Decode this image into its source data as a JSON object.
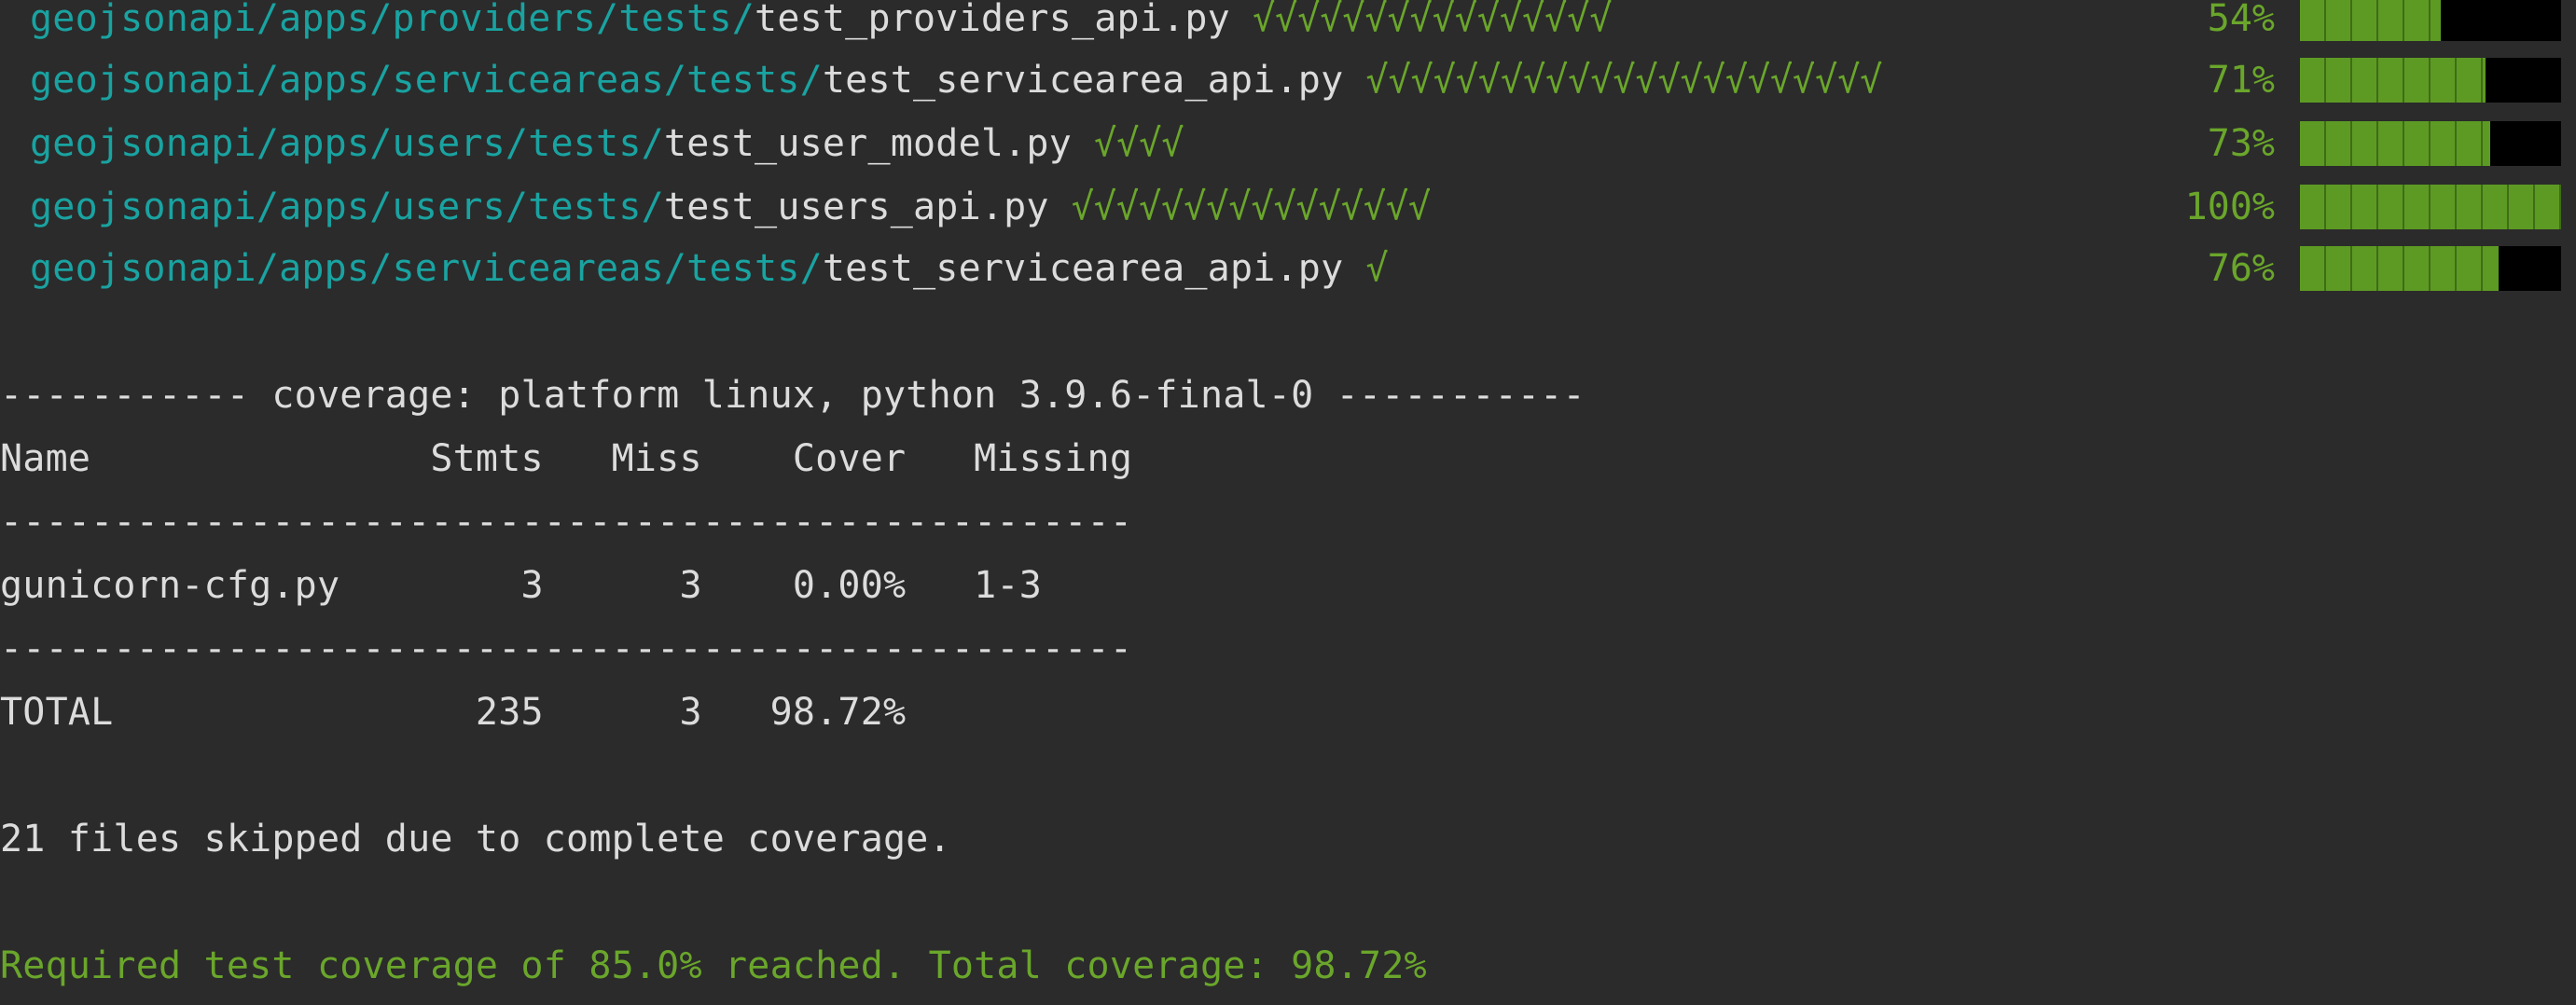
{
  "tests": [
    {
      "dir": "geojsonapi/apps/providers/tests/",
      "file": "test_providers_api.py",
      "checks": "√√√√√√√√√√√√√√√√",
      "percent_label": "54%",
      "progress": 0.54
    },
    {
      "dir": "geojsonapi/apps/serviceareas/tests/",
      "file": "test_servicearea_api.py",
      "checks": "√√√√√√√√√√√√√√√√√√√√√√√",
      "percent_label": "71%",
      "progress": 0.71
    },
    {
      "dir": "geojsonapi/apps/users/tests/",
      "file": "test_user_model.py",
      "checks": "√√√√",
      "percent_label": "73%",
      "progress": 0.73
    },
    {
      "dir": "geojsonapi/apps/users/tests/",
      "file": "test_users_api.py",
      "checks": "√√√√√√√√√√√√√√√√",
      "percent_label": "100%",
      "progress": 1.0
    },
    {
      "dir": "geojsonapi/apps/serviceareas/tests/",
      "file": "test_servicearea_api.py",
      "checks": "√",
      "percent_label": "76%",
      "progress": 0.76
    }
  ],
  "coverage_header": "----------- coverage: platform linux, python 3.9.6-final-0 -----------",
  "table": {
    "header": "Name               Stmts   Miss    Cover   Missing",
    "separator_top": "--------------------------------------------------",
    "rows": [
      "gunicorn-cfg.py        3      3    0.00%   1-3"
    ],
    "separator_bottom": "--------------------------------------------------",
    "total": "TOTAL                235      3   98.72%"
  },
  "skipped_message": "21 files skipped due to complete coverage.",
  "result_message": "Required test coverage of 85.0% reached. Total coverage: 98.72%",
  "colors": {
    "background": "#2b2b2b",
    "path": "#19a3a1",
    "text": "#dcdcdc",
    "success": "#6aa62b",
    "bar_fill": "#5d9a24",
    "bar_empty": "#000000"
  }
}
